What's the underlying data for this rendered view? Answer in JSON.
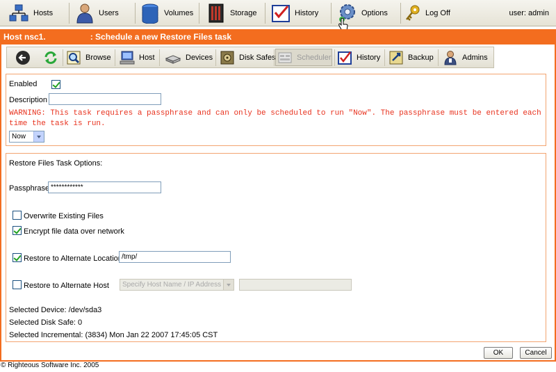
{
  "topnav": {
    "items": [
      {
        "label": "Hosts",
        "icon": "hosts-network-icon"
      },
      {
        "label": "Users",
        "icon": "users-person-icon"
      },
      {
        "label": "Volumes",
        "icon": "volumes-disks-icon"
      },
      {
        "label": "Storage",
        "icon": "storage-server-icon"
      },
      {
        "label": "History",
        "icon": "history-checklist-icon"
      },
      {
        "label": "Options",
        "icon": "options-gear-icon"
      },
      {
        "label": "Log Off",
        "icon": "log-off-key-icon"
      }
    ],
    "user": "user: admin"
  },
  "title": {
    "prefix": "Host nsc1.",
    "suffix": ": Schedule a new Restore Files task"
  },
  "subbar": {
    "items": [
      {
        "label": "",
        "icon": "back-arrow-icon"
      },
      {
        "label": "",
        "icon": "refresh-icon"
      },
      {
        "label": "Browse",
        "icon": "browse-magnifier-icon"
      },
      {
        "label": "Host",
        "icon": "host-computer-icon"
      },
      {
        "label": "Devices",
        "icon": "devices-drive-icon"
      },
      {
        "label": "Disk Safes",
        "icon": "disk-safe-icon"
      },
      {
        "label": "Scheduler",
        "icon": "scheduler-icon"
      },
      {
        "label": "History",
        "icon": "history-checklist-icon"
      },
      {
        "label": "Backup",
        "icon": "backup-icon"
      },
      {
        "label": "Admins",
        "icon": "admins-person-icon"
      }
    ]
  },
  "schedule": {
    "enabled_label": "Enabled",
    "enabled_checked": true,
    "description_label": "Description",
    "description_value": "",
    "warning_line1": "WARNING: This task requires a passphrase and can only be scheduled to run \"Now\". The passphrase must be entered each",
    "warning_line2": "time the task is run.",
    "run_value": "Now"
  },
  "restore": {
    "header": "Restore Files Task Options:",
    "passphrase_label": "Passphrase",
    "passphrase_value": "************",
    "overwrite_label": "Overwrite Existing Files",
    "overwrite_checked": false,
    "encrypt_label": "Encrypt file data over network",
    "encrypt_checked": true,
    "alt_location_label": "Restore to Alternate Location",
    "alt_location_checked": true,
    "alt_location_value": "/tmp/",
    "alt_host_label": "Restore to Alternate Host",
    "alt_host_checked": false,
    "alt_host_select": "Specify Host Name / IP Address",
    "alt_host_value": "",
    "selected_device": "Selected Device: /dev/sda3",
    "selected_disk_safe": "Selected Disk Safe: 0",
    "selected_incremental": "Selected Incremental: (3834) Mon Jan 22 2007 17:45:05 CST"
  },
  "buttons": {
    "ok": "OK",
    "cancel": "Cancel"
  },
  "footer": "© Righteous Software Inc. 2005",
  "colors": {
    "accent": "#f36d1f",
    "warning": "#e8321e",
    "check": "#21a121"
  }
}
